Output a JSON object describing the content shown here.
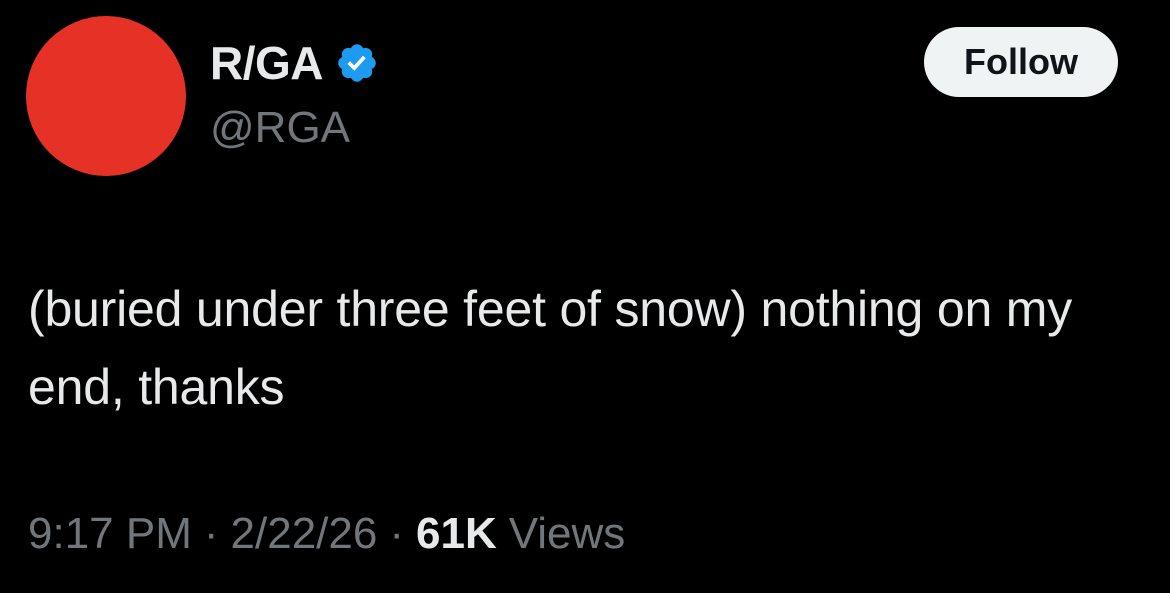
{
  "author": {
    "display_name": "R/GA",
    "handle": "@RGA",
    "verified_icon": "verified-badge-icon",
    "avatar_color": "#e63226",
    "verified_color": "#1d9bf0"
  },
  "actions": {
    "follow_label": "Follow"
  },
  "tweet": {
    "text": "(buried under three feet of snow) nothing on my end, thanks"
  },
  "meta": {
    "time": "9:17 PM",
    "separator": "·",
    "date": "2/22/26",
    "views_count": "61K",
    "views_label": "Views"
  }
}
